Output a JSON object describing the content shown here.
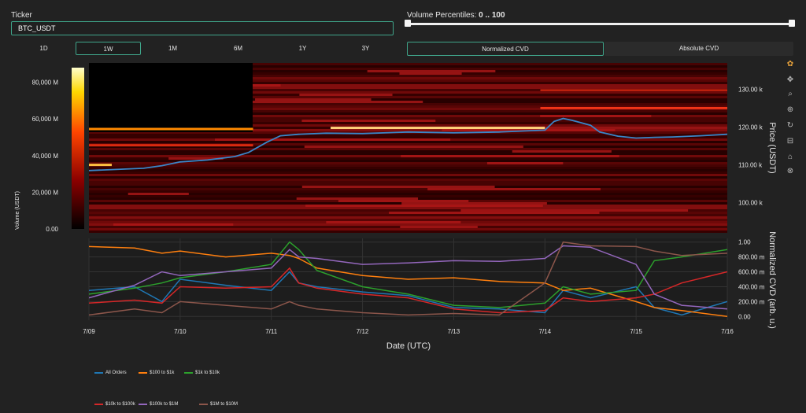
{
  "controls": {
    "ticker_label": "Ticker",
    "ticker_value": "BTC_USDT",
    "volume_label": "Volume Percentiles:",
    "volume_range": "0 .. 100",
    "timeframes": [
      "1D",
      "1W",
      "1M",
      "6M",
      "1Y",
      "3Y"
    ],
    "active_timeframe": "1W",
    "modes": [
      "Normalized CVD",
      "Absolute CVD"
    ],
    "active_mode": "Normalized CVD"
  },
  "chart_data": [
    {
      "type": "heatmap",
      "title": "",
      "xlabel": "",
      "ylabel": "Price (USDT)",
      "colorbar_label": "Volume (USDT)",
      "colorbar_ticks": [
        "0.00",
        "20,000 M",
        "40,000 M",
        "60,000 M",
        "80,000 M"
      ],
      "colorbar_range": [
        0,
        88000
      ],
      "ylim": [
        92000,
        137000
      ],
      "y_ticks": [
        "100.00 k",
        "110.00 k",
        "120.00 k",
        "130.00 k"
      ],
      "x_ticks": [
        "7/09",
        "7/10",
        "7/11",
        "7/12",
        "7/13",
        "7/14",
        "7/15",
        "7/16"
      ],
      "price_series": {
        "name": "Price",
        "x": [
          0.0,
          0.3,
          0.6,
          0.8,
          1.0,
          1.3,
          1.6,
          1.75,
          1.95,
          2.1,
          2.3,
          2.6,
          3.0,
          3.5,
          4.0,
          4.5,
          5.0,
          5.1,
          5.2,
          5.3,
          5.5,
          5.6,
          5.8,
          6.0,
          6.2,
          6.4,
          6.7,
          7.0
        ],
        "y": [
          108500,
          108800,
          109100,
          109800,
          110800,
          111300,
          112200,
          113300,
          116000,
          117700,
          118100,
          118400,
          118300,
          118700,
          118500,
          118700,
          119200,
          121500,
          122300,
          121800,
          120500,
          118700,
          117600,
          117100,
          117300,
          117400,
          117700,
          118100
        ]
      },
      "bright_levels": [
        {
          "from": 2.65,
          "to": 5.0,
          "price": 119800
        },
        {
          "from": 0.0,
          "to": 1.8,
          "price": 119500
        },
        {
          "from": 0.0,
          "to": 0.25,
          "price": 110000
        },
        {
          "from": 0.0,
          "to": 1.8,
          "price": 115200
        }
      ]
    },
    {
      "type": "line",
      "title": "",
      "xlabel": "Date (UTC)",
      "ylabel": "Normalized CVD (arb. u.)",
      "ylim": [
        -0.05,
        1.05
      ],
      "y_ticks": [
        "0.00",
        "200.00 m",
        "400.00 m",
        "600.00 m",
        "800.00 m",
        "1.00"
      ],
      "x": [
        0.0,
        0.5,
        0.8,
        1.0,
        1.5,
        2.0,
        2.2,
        2.3,
        2.5,
        3.0,
        3.5,
        4.0,
        4.5,
        5.0,
        5.2,
        5.5,
        6.0,
        6.2,
        6.5,
        7.0
      ],
      "series": [
        {
          "name": "All Orders",
          "color": "#1f77b4",
          "values": [
            0.35,
            0.4,
            0.2,
            0.5,
            0.42,
            0.35,
            0.6,
            0.45,
            0.4,
            0.33,
            0.28,
            0.12,
            0.1,
            0.05,
            0.35,
            0.25,
            0.4,
            0.12,
            0.02,
            0.2
          ]
        },
        {
          "name": "$100 to $1k",
          "color": "#ff7f0e",
          "values": [
            0.94,
            0.92,
            0.85,
            0.88,
            0.8,
            0.85,
            0.82,
            0.78,
            0.65,
            0.55,
            0.5,
            0.52,
            0.47,
            0.45,
            0.35,
            0.38,
            0.2,
            0.12,
            0.08,
            0.0
          ]
        },
        {
          "name": "$1k to $10k",
          "color": "#2ca02c",
          "values": [
            0.3,
            0.38,
            0.45,
            0.52,
            0.6,
            0.7,
            1.0,
            0.9,
            0.62,
            0.4,
            0.3,
            0.15,
            0.12,
            0.18,
            0.4,
            0.3,
            0.35,
            0.75,
            0.8,
            0.9
          ]
        },
        {
          "name": "$10k to $100k",
          "color": "#d62728",
          "values": [
            0.18,
            0.22,
            0.18,
            0.4,
            0.38,
            0.4,
            0.65,
            0.45,
            0.38,
            0.3,
            0.25,
            0.1,
            0.05,
            0.08,
            0.25,
            0.2,
            0.25,
            0.3,
            0.45,
            0.6
          ]
        },
        {
          "name": "$100k to $1M",
          "color": "#9467bd",
          "values": [
            0.25,
            0.42,
            0.6,
            0.55,
            0.6,
            0.65,
            0.9,
            0.8,
            0.78,
            0.7,
            0.72,
            0.75,
            0.74,
            0.78,
            0.95,
            0.93,
            0.7,
            0.3,
            0.15,
            0.1
          ]
        },
        {
          "name": "$1M to $10M",
          "color": "#8c564b",
          "values": [
            0.02,
            0.1,
            0.05,
            0.2,
            0.15,
            0.1,
            0.2,
            0.15,
            0.1,
            0.05,
            0.02,
            0.04,
            0.02,
            0.45,
            1.0,
            0.95,
            0.94,
            0.88,
            0.82,
            0.85
          ]
        }
      ]
    }
  ]
}
